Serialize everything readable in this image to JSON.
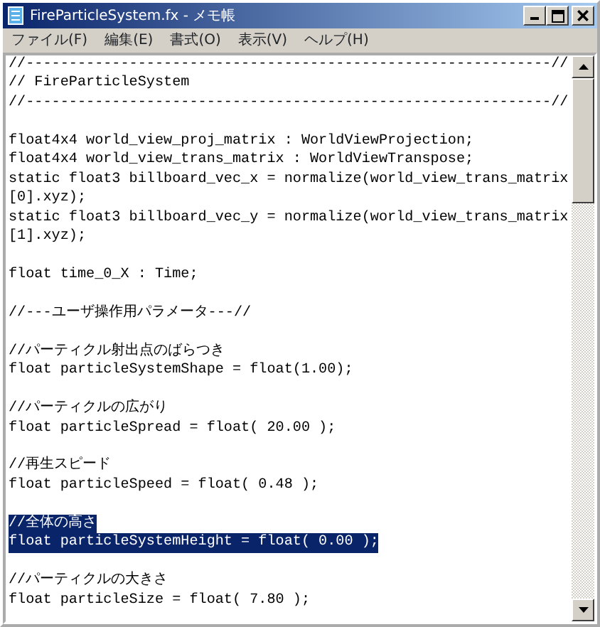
{
  "window": {
    "title": "FireParticleSystem.fx - メモ帳",
    "buttons": [
      {
        "kind": "minimize"
      },
      {
        "kind": "maximize"
      },
      {
        "kind": "close"
      }
    ]
  },
  "menu": [
    "ファイル(F)",
    "編集(E)",
    "書式(O)",
    "表示(V)",
    "ヘルプ(H)"
  ],
  "editor": {
    "blocks": [
      {
        "lines": [
          {
            "text": "//-------------------------------------------------------------//",
            "selected": false
          },
          {
            "text": "// FireParticleSystem",
            "selected": false
          },
          {
            "text": "//-------------------------------------------------------------//",
            "selected": false
          }
        ]
      },
      {
        "lines": [
          {
            "text": "float4x4 world_view_proj_matrix : WorldViewProjection;",
            "selected": false
          },
          {
            "text": "float4x4 world_view_trans_matrix : WorldViewTranspose;",
            "selected": false
          },
          {
            "text": "static float3 billboard_vec_x = normalize(world_view_trans_matrix",
            "selected": false
          },
          {
            "text": "[0].xyz);",
            "selected": false
          },
          {
            "text": "static float3 billboard_vec_y = normalize(world_view_trans_matrix",
            "selected": false
          },
          {
            "text": "[1].xyz);",
            "selected": false
          }
        ]
      },
      {
        "lines": [
          {
            "text": "float time_0_X : Time;",
            "selected": false
          }
        ]
      },
      {
        "lines": [
          {
            "text": "//---ユーザ操作用パラメータ---//",
            "selected": false
          }
        ]
      },
      {
        "lines": [
          {
            "text": "//パーティクル射出点のばらつき",
            "selected": false
          },
          {
            "text": "float particleSystemShape = float(1.00);",
            "selected": false
          }
        ]
      },
      {
        "lines": [
          {
            "text": "//パーティクルの広がり",
            "selected": false
          },
          {
            "text": "float particleSpread = float( 20.00 );",
            "selected": false
          }
        ]
      },
      {
        "lines": [
          {
            "text": "//再生スピード",
            "selected": false
          },
          {
            "text": "float particleSpeed = float( 0.48 );",
            "selected": false
          }
        ]
      },
      {
        "lines": [
          {
            "text": "//全体の高さ",
            "selected": true
          },
          {
            "text": "float particleSystemHeight = float( 0.00 );",
            "selected": true
          }
        ]
      },
      {
        "lines": [
          {
            "text": "//パーティクルの大きさ",
            "selected": false
          },
          {
            "text": "float particleSize = float( 7.80 );",
            "selected": false
          }
        ]
      }
    ]
  }
}
